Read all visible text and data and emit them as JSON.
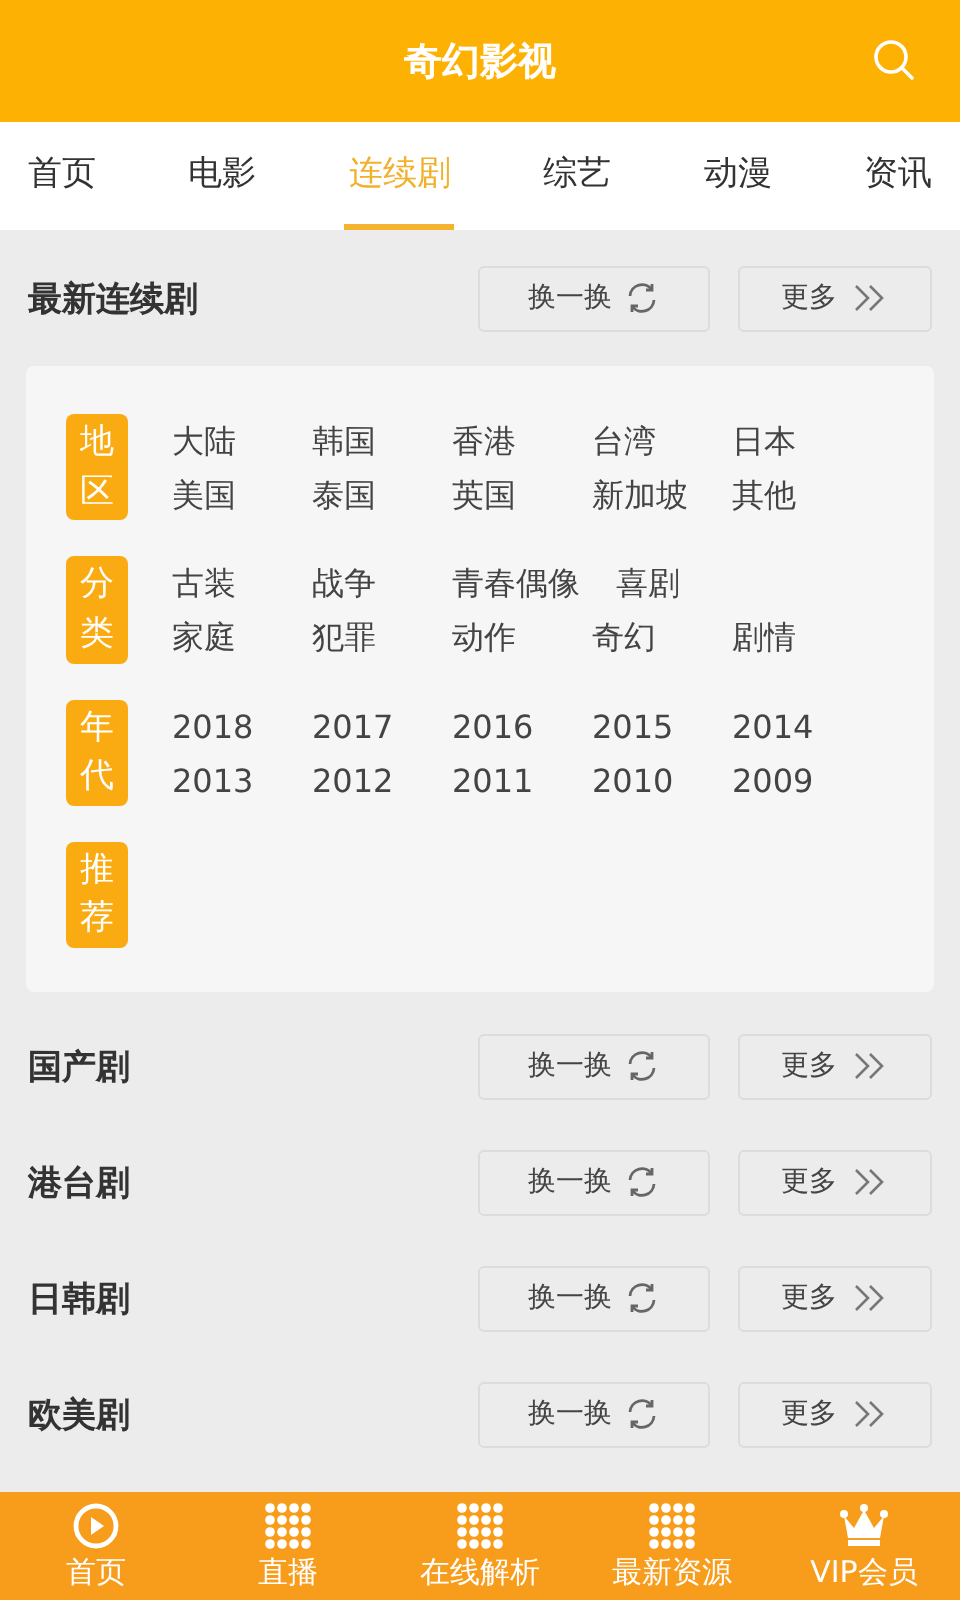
{
  "header": {
    "title": "奇幻影视"
  },
  "tabs": [
    {
      "label": "首页",
      "selected": false
    },
    {
      "label": "电影",
      "selected": false
    },
    {
      "label": "连续剧",
      "selected": true
    },
    {
      "label": "综艺",
      "selected": false
    },
    {
      "label": "动漫",
      "selected": false
    },
    {
      "label": "资讯",
      "selected": false
    }
  ],
  "featured": {
    "title": "最新连续剧",
    "shuffle": "换一换",
    "more": "更多"
  },
  "filters": [
    {
      "label": "地区",
      "options": [
        "大陆",
        "韩国",
        "香港",
        "台湾",
        "日本",
        "美国",
        "泰国",
        "英国",
        "新加坡",
        "其他"
      ]
    },
    {
      "label": "分类",
      "options": [
        "古装",
        "战争",
        "青春偶像",
        "喜剧",
        "家庭",
        "犯罪",
        "动作",
        "奇幻",
        "剧情"
      ]
    },
    {
      "label": "年代",
      "options": [
        "2018",
        "2017",
        "2016",
        "2015",
        "2014",
        "2013",
        "2012",
        "2011",
        "2010",
        "2009"
      ]
    },
    {
      "label": "推荐"
    }
  ],
  "sections": [
    {
      "title": "国产剧",
      "shuffle": "换一换",
      "more": "更多"
    },
    {
      "title": "港台剧",
      "shuffle": "换一换",
      "more": "更多"
    },
    {
      "title": "日韩剧",
      "shuffle": "换一换",
      "more": "更多"
    },
    {
      "title": "欧美剧",
      "shuffle": "换一换",
      "more": "更多"
    }
  ],
  "bottom_nav": [
    {
      "label": "首页",
      "kind": "play"
    },
    {
      "label": "直播",
      "kind": "grid"
    },
    {
      "label": "在线解析",
      "kind": "grid"
    },
    {
      "label": "最新资源",
      "kind": "grid"
    },
    {
      "label": "VIP会员",
      "kind": "crown"
    }
  ]
}
